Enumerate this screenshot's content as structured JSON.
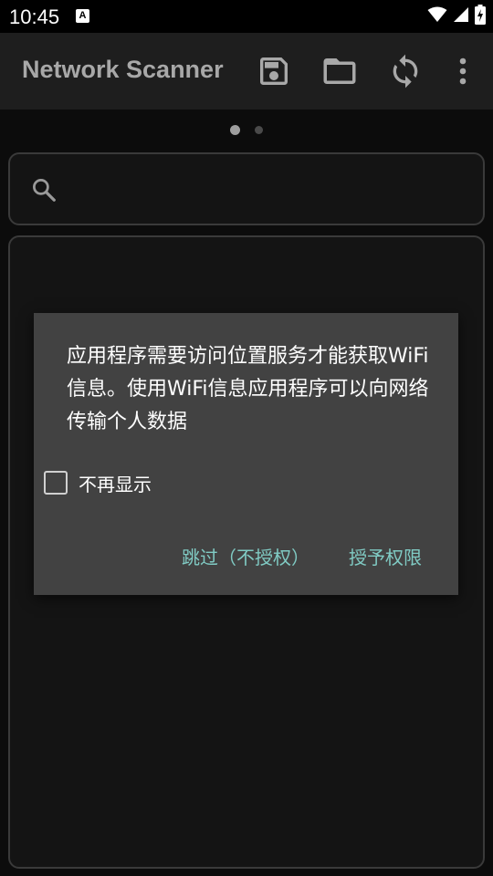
{
  "status_bar": {
    "time": "10:45",
    "notification_icon": "A",
    "icons": [
      "wifi-icon",
      "cell-signal-icon",
      "battery-charging-icon"
    ]
  },
  "toolbar": {
    "title": "Network Scanner",
    "actions": [
      "save-icon",
      "folder-icon",
      "refresh-icon",
      "more-vert-icon"
    ]
  },
  "pager": {
    "count": 2,
    "active_index": 0
  },
  "search": {
    "value": "",
    "placeholder": ""
  },
  "dialog": {
    "message": "应用程序需要访问位置服务才能获取WiFi信息。使用WiFi信息应用程序可以向网络传输个人数据",
    "checkbox_label": "不再显示",
    "checkbox_checked": false,
    "skip_label": "跳过（不授权）",
    "grant_label": "授予权限"
  },
  "colors": {
    "accent": "#80cbc4",
    "dialog_bg": "#424242",
    "toolbar_bg": "#1e1e1e",
    "page_bg": "#0c0c0c",
    "dot_active": "#9e9e9e",
    "dot_inactive": "#4a4a4a"
  }
}
